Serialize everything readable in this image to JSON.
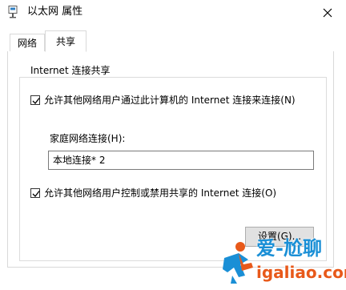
{
  "window": {
    "title": "以太网 属性"
  },
  "tabs": [
    {
      "label": "网络",
      "selected": false
    },
    {
      "label": "共享",
      "selected": true
    }
  ],
  "sharing": {
    "group_title": "Internet 连接共享",
    "allow_share_label": "允许其他网络用户通过此计算机的 Internet 连接来连接(N)",
    "allow_share_checked": true,
    "home_network_label": "家庭网络连接(H):",
    "home_network_value": "本地连接* 2",
    "allow_control_label": "允许其他网络用户控制或禁用共享的 Internet 连接(O)",
    "allow_control_checked": true,
    "settings_button": "设置(G)..."
  },
  "watermark": {
    "brand": "爱-尬聊",
    "url": "igaliao.com"
  },
  "colors": {
    "border": "#d9d9d9",
    "button_bg": "#e1e1e1",
    "watermark_blue": "#1a8fd6",
    "watermark_orange": "#e8591a"
  }
}
